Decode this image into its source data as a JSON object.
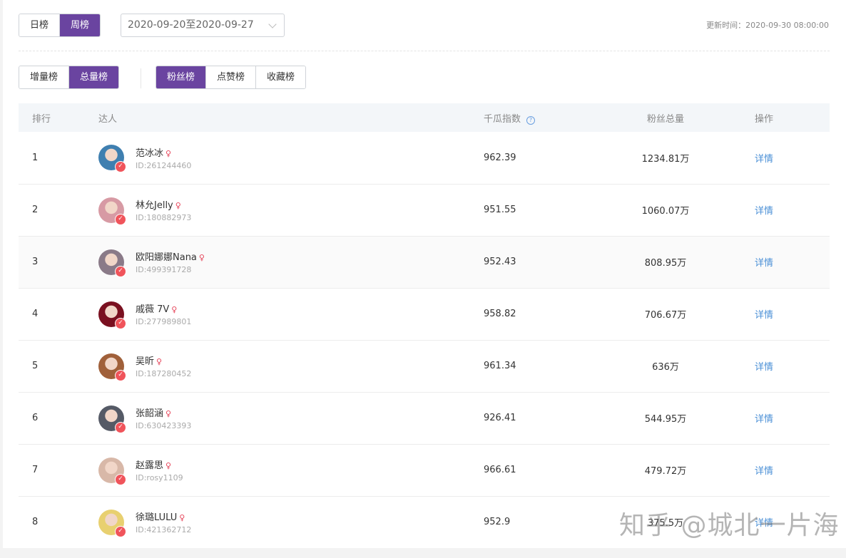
{
  "period_tabs": [
    {
      "label": "日榜",
      "active": false
    },
    {
      "label": "周榜",
      "active": true
    }
  ],
  "date_range": "2020-09-20至2020-09-27",
  "update_time": "更新时间：2020-09-30 08:00:00",
  "mode_tabs": [
    {
      "label": "增量榜",
      "active": false
    },
    {
      "label": "总量榜",
      "active": true
    }
  ],
  "type_tabs": [
    {
      "label": "粉丝榜",
      "active": true
    },
    {
      "label": "点赞榜",
      "active": false
    },
    {
      "label": "收藏榜",
      "active": false
    }
  ],
  "columns": {
    "rank": "排行",
    "person": "达人",
    "index": "千瓜指数",
    "fans": "粉丝总量",
    "action": "操作"
  },
  "rows": [
    {
      "rank": "1",
      "name": "范冰冰",
      "id": "ID:261244460",
      "index": "962.39",
      "fans": "1234.81万",
      "action": "详情",
      "avatar": "#3f7fb0"
    },
    {
      "rank": "2",
      "name": "林允Jelly",
      "id": "ID:180882973",
      "index": "951.55",
      "fans": "1060.07万",
      "action": "详情",
      "avatar": "#d79aa4"
    },
    {
      "rank": "3",
      "name": "欧阳娜娜Nana",
      "id": "ID:499391728",
      "index": "952.43",
      "fans": "808.95万",
      "action": "详情",
      "avatar": "#8a7a88"
    },
    {
      "rank": "4",
      "name": "戚薇 7V",
      "id": "ID:277989801",
      "index": "958.82",
      "fans": "706.67万",
      "action": "详情",
      "avatar": "#7a1020"
    },
    {
      "rank": "5",
      "name": "吴昕",
      "id": "ID:187280452",
      "index": "961.34",
      "fans": "636万",
      "action": "详情",
      "avatar": "#a0603a"
    },
    {
      "rank": "6",
      "name": "张韶涵",
      "id": "ID:630423393",
      "index": "926.41",
      "fans": "544.95万",
      "action": "详情",
      "avatar": "#555a66"
    },
    {
      "rank": "7",
      "name": "赵露思",
      "id": "ID:rosy1109",
      "index": "966.61",
      "fans": "479.72万",
      "action": "详情",
      "avatar": "#d8b8a8"
    },
    {
      "rank": "8",
      "name": "徐璐LULU",
      "id": "ID:421362712",
      "index": "952.9",
      "fans": "375.5万",
      "action": "详情",
      "avatar": "#e8d070"
    }
  ],
  "watermark": "知乎 @城北一片海",
  "colors": {
    "accent": "#6a44a0",
    "link": "#4a8fd6",
    "verified": "#f0545b"
  }
}
